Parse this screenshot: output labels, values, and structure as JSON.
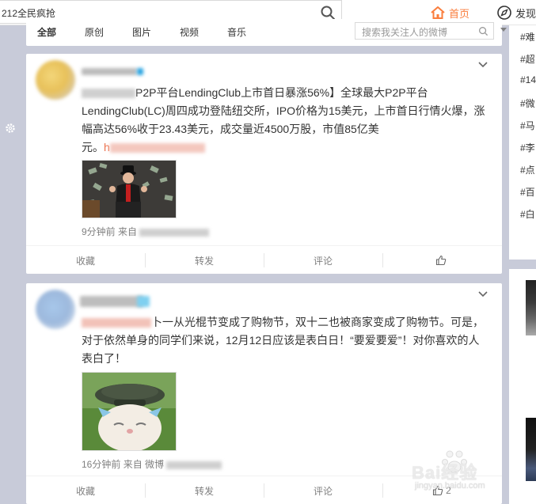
{
  "topbar": {
    "search_text": "212全民疯抢",
    "nav_home": "首页",
    "nav_discover": "发现"
  },
  "feed_tabs": {
    "tabs": [
      "全部",
      "原创",
      "图片",
      "视频",
      "音乐"
    ],
    "search_placeholder": "搜索我关注人的微博"
  },
  "posts": [
    {
      "text_line1": "P2P平台LendingClub上市首日暴涨56%】全球最大P2P平台",
      "text_line2": "LendingClub(LC)周四成功登陆纽交所，IPO价格为15美元，上市首日行情火爆，涨",
      "text_line3": "幅高达56%收于23.43美元，成交量近4500万股，市值85亿美",
      "text_line4": "元。",
      "link_text": "h",
      "meta_time": "9分钟前",
      "meta_from": "来自",
      "actions": {
        "favorite": "收藏",
        "repost": "转发",
        "comment": "评论",
        "like_count": ""
      }
    },
    {
      "text_line1": "卜一从光棍节变成了购物节，双十二也被商家变成了购物节。可是，",
      "text_line2": "对于依然单身的同学们来说，12月12日应该是表白日！“要爱要爱”！对你喜欢的人",
      "text_line3": "表白了！",
      "meta_time": "16分钟前",
      "meta_from": "来自 微博",
      "actions": {
        "favorite": "收藏",
        "repost": "转发",
        "comment": "评论",
        "like_count": "2"
      }
    }
  ],
  "sidebar": {
    "topics": [
      "#难",
      "#超",
      "#14",
      "#微",
      "#马",
      "#李",
      "#点",
      "#百",
      "#白"
    ]
  },
  "watermark": {
    "text": "Bai经验",
    "sub": "jingyan.baidu.com"
  },
  "colors": {
    "accent": "#fa7d3c",
    "link": "#eb7350",
    "background": "#c8cbd9"
  }
}
